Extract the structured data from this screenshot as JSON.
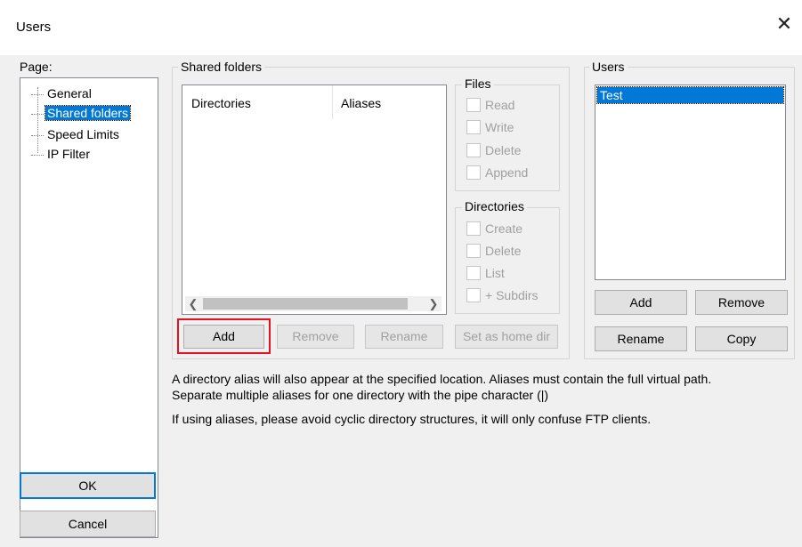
{
  "window": {
    "title": "Users",
    "close_glyph": "✕"
  },
  "page_panel": {
    "label": "Page:",
    "items": [
      {
        "label": "General",
        "selected": false
      },
      {
        "label": "Shared folders",
        "selected": true
      },
      {
        "label": "Speed Limits",
        "selected": false
      },
      {
        "label": "IP Filter",
        "selected": false
      }
    ]
  },
  "shared_folders": {
    "group_title": "Shared folders",
    "columns": [
      "Directories",
      "Aliases"
    ],
    "buttons": {
      "add": "Add",
      "remove": "Remove",
      "rename": "Rename",
      "set_home": "Set as home dir"
    }
  },
  "files_group": {
    "title": "Files",
    "options": [
      "Read",
      "Write",
      "Delete",
      "Append"
    ]
  },
  "directories_group": {
    "title": "Directories",
    "options": [
      "Create",
      "Delete",
      "List",
      "+ Subdirs"
    ]
  },
  "users_panel": {
    "title": "Users",
    "users": [
      "Test"
    ],
    "buttons": {
      "add": "Add",
      "remove": "Remove",
      "rename": "Rename",
      "copy": "Copy"
    }
  },
  "info": {
    "line1": "A directory alias will also appear at the specified location. Aliases must contain the full virtual path. Separate multiple aliases for one directory with the pipe character (|)",
    "line2": "If using aliases, please avoid cyclic directory structures, it will only confuse FTP clients."
  },
  "dialog_buttons": {
    "ok": "OK",
    "cancel": "Cancel"
  },
  "colors": {
    "selection": "#0078d7",
    "highlight_border": "#e81123"
  }
}
